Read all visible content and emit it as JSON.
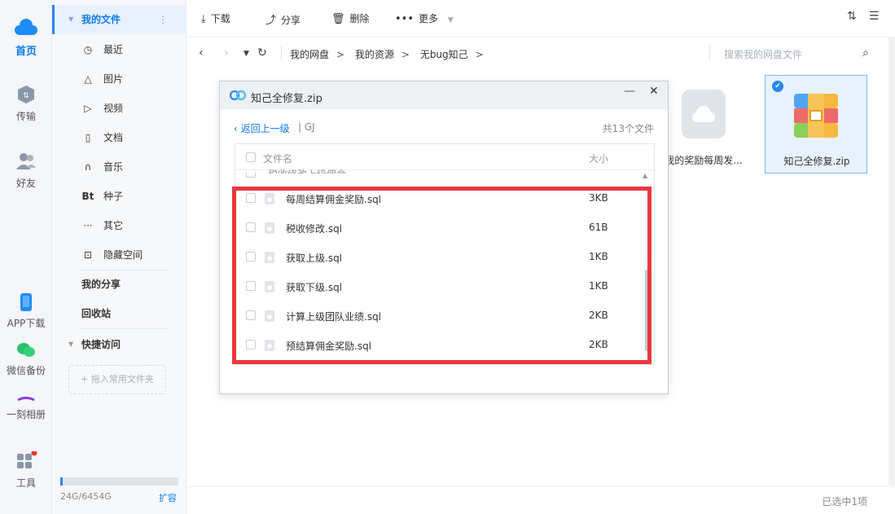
{
  "rail": {
    "items": [
      {
        "label": "首页",
        "icon": "cloud-icon"
      },
      {
        "label": "传输",
        "icon": "transfer-icon"
      },
      {
        "label": "好友",
        "icon": "friends-icon"
      },
      {
        "label": "APP下载",
        "icon": "phone-icon"
      },
      {
        "label": "微信备份",
        "icon": "wechat-icon"
      },
      {
        "label": "一刻相册",
        "icon": "album-icon"
      },
      {
        "label": "工具",
        "icon": "apps-icon"
      }
    ]
  },
  "sidebar": {
    "my_files": "我的文件",
    "items": [
      {
        "label": "最近",
        "icon": "◷"
      },
      {
        "label": "图片",
        "icon": "△"
      },
      {
        "label": "视频",
        "icon": "▷"
      },
      {
        "label": "文档",
        "icon": "▯"
      },
      {
        "label": "音乐",
        "icon": "∩"
      },
      {
        "label": "种子",
        "icon": "Bt"
      },
      {
        "label": "其它",
        "icon": "···"
      },
      {
        "label": "隐藏空间",
        "icon": "⊡"
      }
    ],
    "my_share": "我的分享",
    "recycle": "回收站",
    "quick_access": "快捷访问",
    "drag_hint": "+ 拖入常用文件夹",
    "quota": "24G/6454G",
    "quota_fraction": 0.004,
    "expand": "扩容"
  },
  "toolbar": {
    "download": "下载",
    "share": "分享",
    "delete": "删除",
    "more": "更多"
  },
  "nav": {
    "crumbs": [
      "我的网盘",
      "我的资源",
      "无bug知己"
    ],
    "search_placeholder": "搜索我的网盘文件"
  },
  "tiles": [
    {
      "name": "我的奖励每周发...",
      "icon": "cloud-file-icon",
      "selected": false
    },
    {
      "name": "知己全修复.zip",
      "icon": "zip-icon",
      "selected": true
    }
  ],
  "status": {
    "text": "已选中1项"
  },
  "dialog": {
    "title": "知己全修复.zip",
    "back": "返回上一级",
    "path": "GJ",
    "count": "共13个文件",
    "col_name": "文件名",
    "col_size": "大小",
    "partial_row": "税收修改上级佣金...",
    "files": [
      {
        "name": "每周结算佣金奖励.sql",
        "size": "3KB"
      },
      {
        "name": "税收修改.sql",
        "size": "61B"
      },
      {
        "name": "获取上级.sql",
        "size": "1KB"
      },
      {
        "name": "获取下级.sql",
        "size": "1KB"
      },
      {
        "name": "计算上级团队业绩.sql",
        "size": "2KB"
      },
      {
        "name": "预结算佣金奖励.sql",
        "size": "2KB"
      }
    ]
  },
  "colors": {
    "accent": "#0a7cf0",
    "highlight": "#e8383d",
    "selected_tile": "#e7f2fd"
  }
}
